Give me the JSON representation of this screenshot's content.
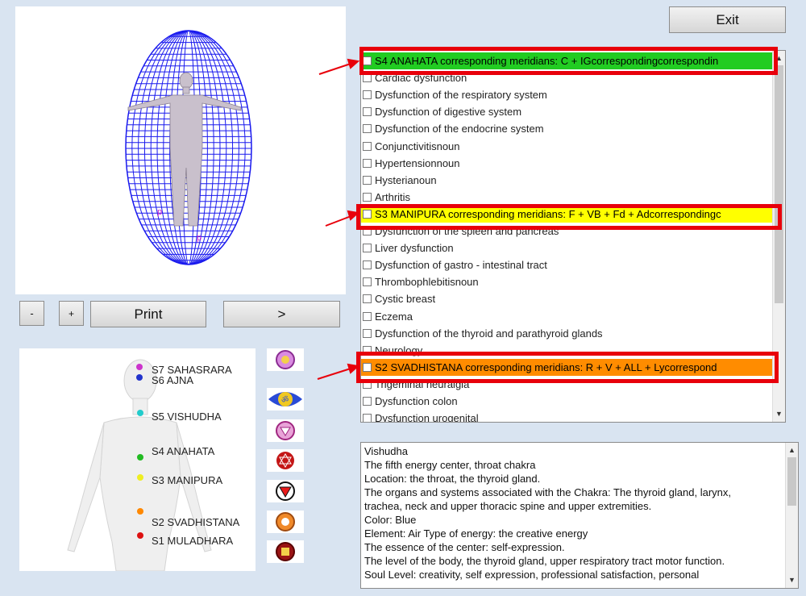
{
  "toolbar": {
    "exit_label": "Exit",
    "minus_label": "-",
    "plus_label": "+",
    "print_label": "Print",
    "next_label": ">"
  },
  "chakras": [
    {
      "label": "S7 SAHASRARA",
      "color": "#cc33cc"
    },
    {
      "label": "S6 AJNA",
      "color": "#2233cc"
    },
    {
      "label": "S5 VISHUDHA",
      "color": "#22cccc"
    },
    {
      "label": "S4 ANAHATA",
      "color": "#22bb22"
    },
    {
      "label": "S3 MANIPURA",
      "color": "#eeee22"
    },
    {
      "label": "S2 SVADHISTANA",
      "color": "#ff8800"
    },
    {
      "label": "S1 MULADHARA",
      "color": "#dd1111"
    }
  ],
  "chakra_icons": [
    "sahasrara-icon",
    "ajna-icon",
    "vishudha-icon",
    "anahata-icon",
    "manipura-icon",
    "svadhistana-icon",
    "muladhara-icon"
  ],
  "list": {
    "rows": [
      {
        "text": "S4 ANAHATA corresponding meridians: C + IGcorrespondingcorrespondin",
        "bg": "#22cc22"
      },
      {
        "text": "Cardiac dysfunction"
      },
      {
        "text": "Dysfunction of the respiratory system"
      },
      {
        "text": "Dysfunction of digestive system"
      },
      {
        "text": "Dysfunction of the endocrine system"
      },
      {
        "text": "Conjunctivitisnoun"
      },
      {
        "text": "Hypertensionnoun"
      },
      {
        "text": "Hysterianoun"
      },
      {
        "text": "Arthritis"
      },
      {
        "text": "S3 MANIPURA corresponding meridians: F + VB + Fd + Adcorrespondingc",
        "bg": "#ffff00"
      },
      {
        "text": "Dysfunction of the spleen and pancreas"
      },
      {
        "text": "Liver dysfunction"
      },
      {
        "text": "Dysfunction of gastro - intestinal tract"
      },
      {
        "text": "Thrombophlebitisnoun"
      },
      {
        "text": "Cystic breast"
      },
      {
        "text": "Eczema"
      },
      {
        "text": "Dysfunction of the thyroid and parathyroid glands"
      },
      {
        "text": "Neurology"
      },
      {
        "text": "S2 SVADHISTANA corresponding meridians: R + V + ALL + Lycorrespond",
        "bg": "#ff8c00"
      },
      {
        "text": "Trigeminal neuralgia"
      },
      {
        "text": "Dysfunction colon"
      },
      {
        "text": "Dysfunction urogenital"
      }
    ]
  },
  "info": {
    "lines": [
      "Vishudha",
      "The fifth energy center, throat chakra",
      "Location: the throat, the thyroid gland.",
      "The organs and systems associated with the Chakra: The thyroid gland, larynx,",
      "trachea, neck and upper thoracic spine and upper extremities.",
      "Color: Blue",
      "Element: Air Type of energy: the creative energy",
      "The essence of the center: self-expression.",
      "The level of the body, the thyroid gland, upper respiratory tract motor function.",
      "Soul Level: creativity, self expression, professional satisfaction, personal"
    ]
  },
  "colors": {
    "highlight_border": "#e8000b",
    "mesh": "#1a1aee",
    "arrow": "#e8000b"
  }
}
